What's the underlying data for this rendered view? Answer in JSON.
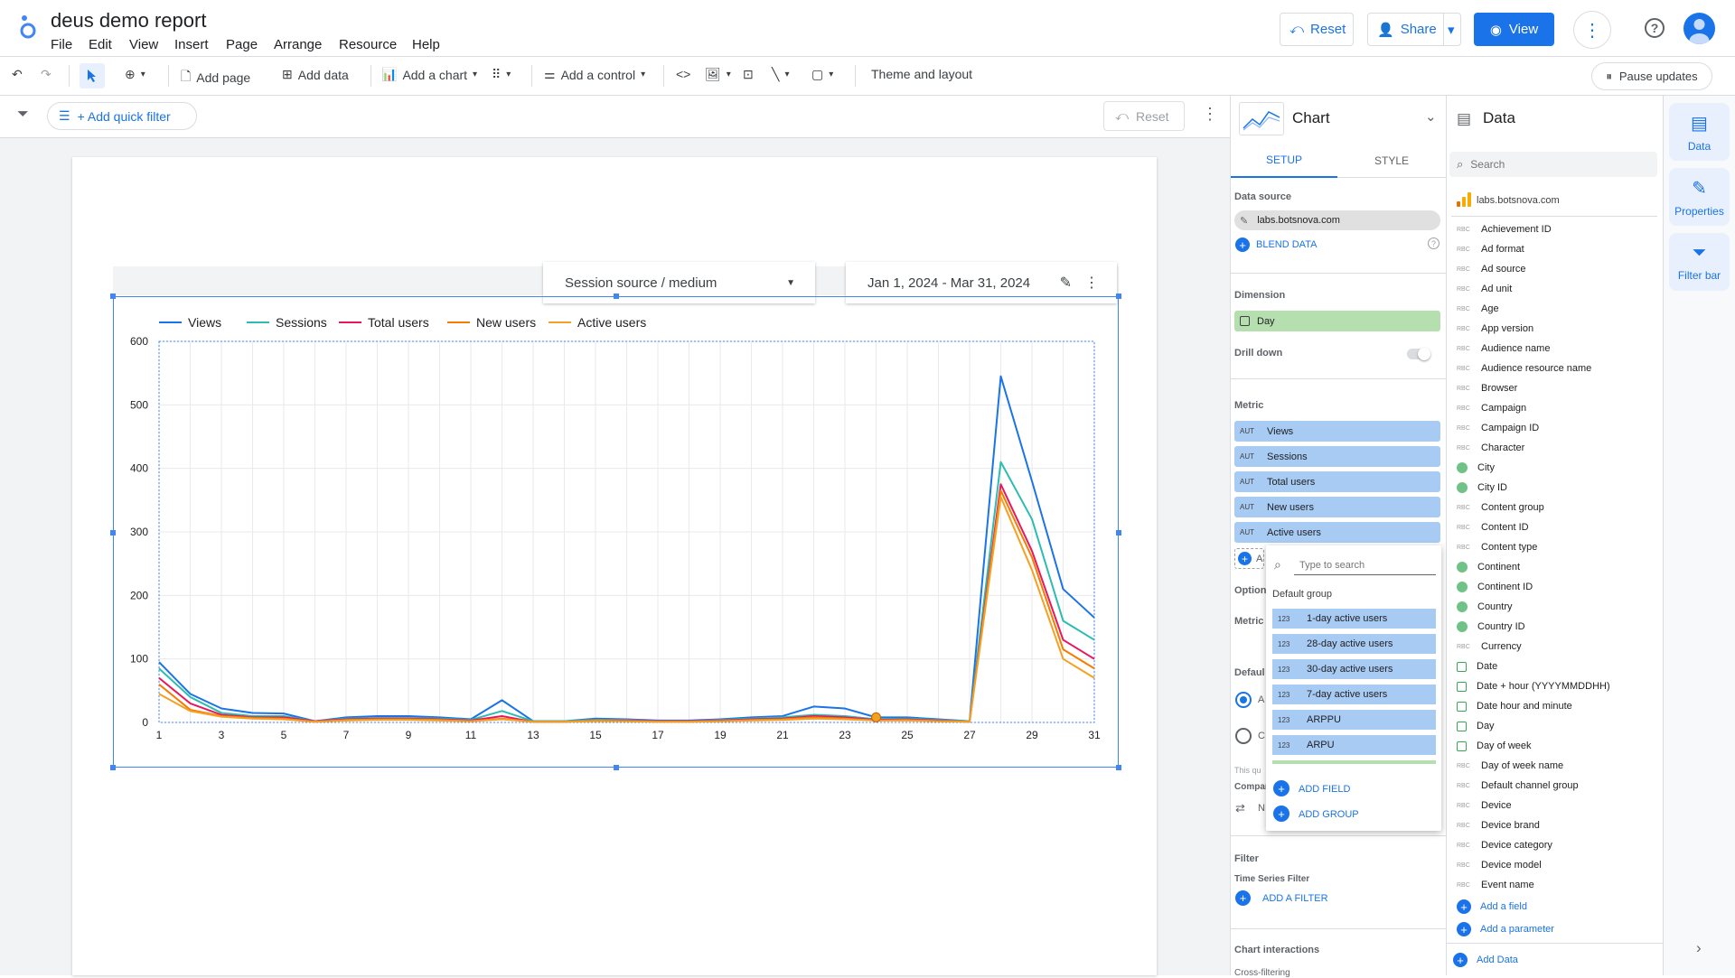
{
  "app": {
    "title": "deus demo report"
  },
  "menu": [
    "File",
    "Edit",
    "View",
    "Insert",
    "Page",
    "Arrange",
    "Resource",
    "Help"
  ],
  "header": {
    "reset_label": "Reset",
    "share_label": "Share",
    "view_label": "View"
  },
  "toolbar": {
    "add_page": "Add page",
    "add_data": "Add data",
    "add_chart": "Add a chart",
    "add_control": "Add a control",
    "theme": "Theme and layout",
    "pause": "Pause updates"
  },
  "filterbar": {
    "quick_filter": "+ Add quick filter",
    "reset": "Reset"
  },
  "controls": {
    "source_dropdown": "Session source / medium",
    "date_range": "Jan 1, 2024 - Mar 31, 2024"
  },
  "chart_data": {
    "type": "line",
    "x": [
      1,
      2,
      3,
      4,
      5,
      6,
      7,
      8,
      9,
      10,
      11,
      12,
      13,
      14,
      15,
      16,
      17,
      18,
      19,
      20,
      21,
      22,
      23,
      24,
      25,
      26,
      27,
      28,
      29,
      30,
      31
    ],
    "xticks": [
      1,
      3,
      5,
      7,
      9,
      11,
      13,
      15,
      17,
      19,
      21,
      23,
      25,
      27,
      29,
      31
    ],
    "ylim": [
      0,
      600
    ],
    "yticks": [
      0,
      100,
      200,
      300,
      400,
      500,
      600
    ],
    "series": [
      {
        "name": "Views",
        "color": "#1a73e8",
        "values": [
          95,
          45,
          22,
          15,
          14,
          2,
          8,
          10,
          10,
          8,
          5,
          35,
          2,
          2,
          6,
          5,
          3,
          3,
          5,
          8,
          10,
          25,
          22,
          8,
          8,
          5,
          2,
          545,
          380,
          210,
          165
        ]
      },
      {
        "name": "Sessions",
        "color": "#2bbcb2",
        "values": [
          85,
          40,
          15,
          10,
          10,
          2,
          6,
          7,
          7,
          6,
          4,
          18,
          2,
          2,
          4,
          4,
          2,
          2,
          4,
          6,
          8,
          12,
          10,
          5,
          6,
          4,
          2,
          410,
          320,
          160,
          130
        ]
      },
      {
        "name": "Total users",
        "color": "#e8175d",
        "values": [
          70,
          30,
          12,
          8,
          8,
          2,
          5,
          6,
          6,
          5,
          3,
          10,
          1,
          1,
          3,
          3,
          2,
          2,
          3,
          5,
          6,
          10,
          8,
          4,
          5,
          3,
          1,
          375,
          270,
          130,
          100
        ]
      },
      {
        "name": "New users",
        "color": "#f57c00",
        "values": [
          60,
          20,
          10,
          7,
          6,
          1,
          4,
          5,
          5,
          4,
          2,
          6,
          1,
          1,
          3,
          2,
          1,
          1,
          2,
          4,
          5,
          8,
          6,
          3,
          4,
          2,
          1,
          365,
          260,
          115,
          85
        ]
      },
      {
        "name": "Active users",
        "color": "#f4a022",
        "values": [
          45,
          18,
          9,
          6,
          5,
          1,
          3,
          4,
          4,
          3,
          2,
          5,
          1,
          1,
          2,
          2,
          1,
          1,
          2,
          3,
          4,
          6,
          5,
          3,
          3,
          2,
          1,
          355,
          240,
          100,
          70
        ]
      }
    ]
  },
  "chart_panel": {
    "title": "Chart",
    "tab_setup": "SETUP",
    "tab_style": "STYLE",
    "data_source_label": "Data source",
    "data_source": "labs.botsnova.com",
    "blend": "BLEND DATA",
    "dimension_label": "Dimension",
    "dimension": "Day",
    "drill_down": "Drill down",
    "metric_label": "Metric",
    "metrics": [
      "Views",
      "Sessions",
      "Total users",
      "New users",
      "Active users"
    ],
    "metric_type": "AUT",
    "partial": {
      "optional": "Optiona",
      "metric_sl": "Metric",
      "default": "Defaul",
      "a": "A",
      "c": "C",
      "this_qu": "This qu",
      "compar": "Compar",
      "n": "N"
    },
    "filter_label": "Filter",
    "ts_filter": "Time Series Filter",
    "add_filter": "ADD A FILTER",
    "interactions": "Chart interactions",
    "cross": "Cross-filtering"
  },
  "popup": {
    "search_placeholder": "Type to search",
    "group": "Default group",
    "type_badge": "123",
    "items": [
      "1-day active users",
      "28-day active users",
      "30-day active users",
      "7-day active users",
      "ARPPU",
      "ARPU"
    ],
    "add_field": "ADD FIELD",
    "add_group": "ADD GROUP"
  },
  "data_panel": {
    "title": "Data",
    "search_placeholder": "Search",
    "source": "labs.botsnova.com",
    "fields": [
      {
        "name": "Achievement ID",
        "type": "RBC"
      },
      {
        "name": "Ad format",
        "type": "RBC"
      },
      {
        "name": "Ad source",
        "type": "RBC"
      },
      {
        "name": "Ad unit",
        "type": "RBC"
      },
      {
        "name": "Age",
        "type": "RBC"
      },
      {
        "name": "App version",
        "type": "RBC"
      },
      {
        "name": "Audience name",
        "type": "RBC"
      },
      {
        "name": "Audience resource name",
        "type": "RBC"
      },
      {
        "name": "Browser",
        "type": "RBC"
      },
      {
        "name": "Campaign",
        "type": "RBC"
      },
      {
        "name": "Campaign ID",
        "type": "RBC"
      },
      {
        "name": "Character",
        "type": "RBC"
      },
      {
        "name": "City",
        "type": "geo"
      },
      {
        "name": "City ID",
        "type": "geo"
      },
      {
        "name": "Content group",
        "type": "RBC"
      },
      {
        "name": "Content ID",
        "type": "RBC"
      },
      {
        "name": "Content type",
        "type": "RBC"
      },
      {
        "name": "Continent",
        "type": "geo"
      },
      {
        "name": "Continent ID",
        "type": "geo"
      },
      {
        "name": "Country",
        "type": "geo"
      },
      {
        "name": "Country ID",
        "type": "geo"
      },
      {
        "name": "Currency",
        "type": "RBC"
      },
      {
        "name": "Date",
        "type": "cal"
      },
      {
        "name": "Date + hour (YYYYMMDDHH)",
        "type": "cal"
      },
      {
        "name": "Date hour and minute",
        "type": "cal"
      },
      {
        "name": "Day",
        "type": "cal"
      },
      {
        "name": "Day of week",
        "type": "cal"
      },
      {
        "name": "Day of week name",
        "type": "RBC"
      },
      {
        "name": "Default channel group",
        "type": "RBC"
      },
      {
        "name": "Device",
        "type": "RBC"
      },
      {
        "name": "Device brand",
        "type": "RBC"
      },
      {
        "name": "Device category",
        "type": "RBC"
      },
      {
        "name": "Device model",
        "type": "RBC"
      },
      {
        "name": "Event name",
        "type": "RBC"
      }
    ],
    "add_field": "Add a field",
    "add_param": "Add a parameter",
    "add_data": "Add Data"
  },
  "rail": {
    "data": "Data",
    "properties": "Properties",
    "filter_bar": "Filter bar"
  }
}
